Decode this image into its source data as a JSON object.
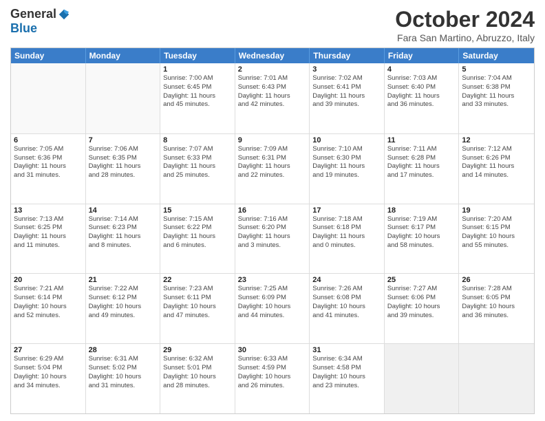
{
  "logo": {
    "general": "General",
    "blue": "Blue"
  },
  "title": "October 2024",
  "location": "Fara San Martino, Abruzzo, Italy",
  "days": [
    "Sunday",
    "Monday",
    "Tuesday",
    "Wednesday",
    "Thursday",
    "Friday",
    "Saturday"
  ],
  "weeks": [
    [
      {
        "day": "",
        "content": "",
        "empty": true
      },
      {
        "day": "",
        "content": "",
        "empty": true
      },
      {
        "day": "1",
        "content": "Sunrise: 7:00 AM\nSunset: 6:45 PM\nDaylight: 11 hours\nand 45 minutes."
      },
      {
        "day": "2",
        "content": "Sunrise: 7:01 AM\nSunset: 6:43 PM\nDaylight: 11 hours\nand 42 minutes."
      },
      {
        "day": "3",
        "content": "Sunrise: 7:02 AM\nSunset: 6:41 PM\nDaylight: 11 hours\nand 39 minutes."
      },
      {
        "day": "4",
        "content": "Sunrise: 7:03 AM\nSunset: 6:40 PM\nDaylight: 11 hours\nand 36 minutes."
      },
      {
        "day": "5",
        "content": "Sunrise: 7:04 AM\nSunset: 6:38 PM\nDaylight: 11 hours\nand 33 minutes."
      }
    ],
    [
      {
        "day": "6",
        "content": "Sunrise: 7:05 AM\nSunset: 6:36 PM\nDaylight: 11 hours\nand 31 minutes."
      },
      {
        "day": "7",
        "content": "Sunrise: 7:06 AM\nSunset: 6:35 PM\nDaylight: 11 hours\nand 28 minutes."
      },
      {
        "day": "8",
        "content": "Sunrise: 7:07 AM\nSunset: 6:33 PM\nDaylight: 11 hours\nand 25 minutes."
      },
      {
        "day": "9",
        "content": "Sunrise: 7:09 AM\nSunset: 6:31 PM\nDaylight: 11 hours\nand 22 minutes."
      },
      {
        "day": "10",
        "content": "Sunrise: 7:10 AM\nSunset: 6:30 PM\nDaylight: 11 hours\nand 19 minutes."
      },
      {
        "day": "11",
        "content": "Sunrise: 7:11 AM\nSunset: 6:28 PM\nDaylight: 11 hours\nand 17 minutes."
      },
      {
        "day": "12",
        "content": "Sunrise: 7:12 AM\nSunset: 6:26 PM\nDaylight: 11 hours\nand 14 minutes."
      }
    ],
    [
      {
        "day": "13",
        "content": "Sunrise: 7:13 AM\nSunset: 6:25 PM\nDaylight: 11 hours\nand 11 minutes."
      },
      {
        "day": "14",
        "content": "Sunrise: 7:14 AM\nSunset: 6:23 PM\nDaylight: 11 hours\nand 8 minutes."
      },
      {
        "day": "15",
        "content": "Sunrise: 7:15 AM\nSunset: 6:22 PM\nDaylight: 11 hours\nand 6 minutes."
      },
      {
        "day": "16",
        "content": "Sunrise: 7:16 AM\nSunset: 6:20 PM\nDaylight: 11 hours\nand 3 minutes."
      },
      {
        "day": "17",
        "content": "Sunrise: 7:18 AM\nSunset: 6:18 PM\nDaylight: 11 hours\nand 0 minutes."
      },
      {
        "day": "18",
        "content": "Sunrise: 7:19 AM\nSunset: 6:17 PM\nDaylight: 10 hours\nand 58 minutes."
      },
      {
        "day": "19",
        "content": "Sunrise: 7:20 AM\nSunset: 6:15 PM\nDaylight: 10 hours\nand 55 minutes."
      }
    ],
    [
      {
        "day": "20",
        "content": "Sunrise: 7:21 AM\nSunset: 6:14 PM\nDaylight: 10 hours\nand 52 minutes."
      },
      {
        "day": "21",
        "content": "Sunrise: 7:22 AM\nSunset: 6:12 PM\nDaylight: 10 hours\nand 49 minutes."
      },
      {
        "day": "22",
        "content": "Sunrise: 7:23 AM\nSunset: 6:11 PM\nDaylight: 10 hours\nand 47 minutes."
      },
      {
        "day": "23",
        "content": "Sunrise: 7:25 AM\nSunset: 6:09 PM\nDaylight: 10 hours\nand 44 minutes."
      },
      {
        "day": "24",
        "content": "Sunrise: 7:26 AM\nSunset: 6:08 PM\nDaylight: 10 hours\nand 41 minutes."
      },
      {
        "day": "25",
        "content": "Sunrise: 7:27 AM\nSunset: 6:06 PM\nDaylight: 10 hours\nand 39 minutes."
      },
      {
        "day": "26",
        "content": "Sunrise: 7:28 AM\nSunset: 6:05 PM\nDaylight: 10 hours\nand 36 minutes."
      }
    ],
    [
      {
        "day": "27",
        "content": "Sunrise: 6:29 AM\nSunset: 5:04 PM\nDaylight: 10 hours\nand 34 minutes."
      },
      {
        "day": "28",
        "content": "Sunrise: 6:31 AM\nSunset: 5:02 PM\nDaylight: 10 hours\nand 31 minutes."
      },
      {
        "day": "29",
        "content": "Sunrise: 6:32 AM\nSunset: 5:01 PM\nDaylight: 10 hours\nand 28 minutes."
      },
      {
        "day": "30",
        "content": "Sunrise: 6:33 AM\nSunset: 4:59 PM\nDaylight: 10 hours\nand 26 minutes."
      },
      {
        "day": "31",
        "content": "Sunrise: 6:34 AM\nSunset: 4:58 PM\nDaylight: 10 hours\nand 23 minutes."
      },
      {
        "day": "",
        "content": "",
        "empty": true,
        "shaded": true
      },
      {
        "day": "",
        "content": "",
        "empty": true,
        "shaded": true
      }
    ]
  ]
}
